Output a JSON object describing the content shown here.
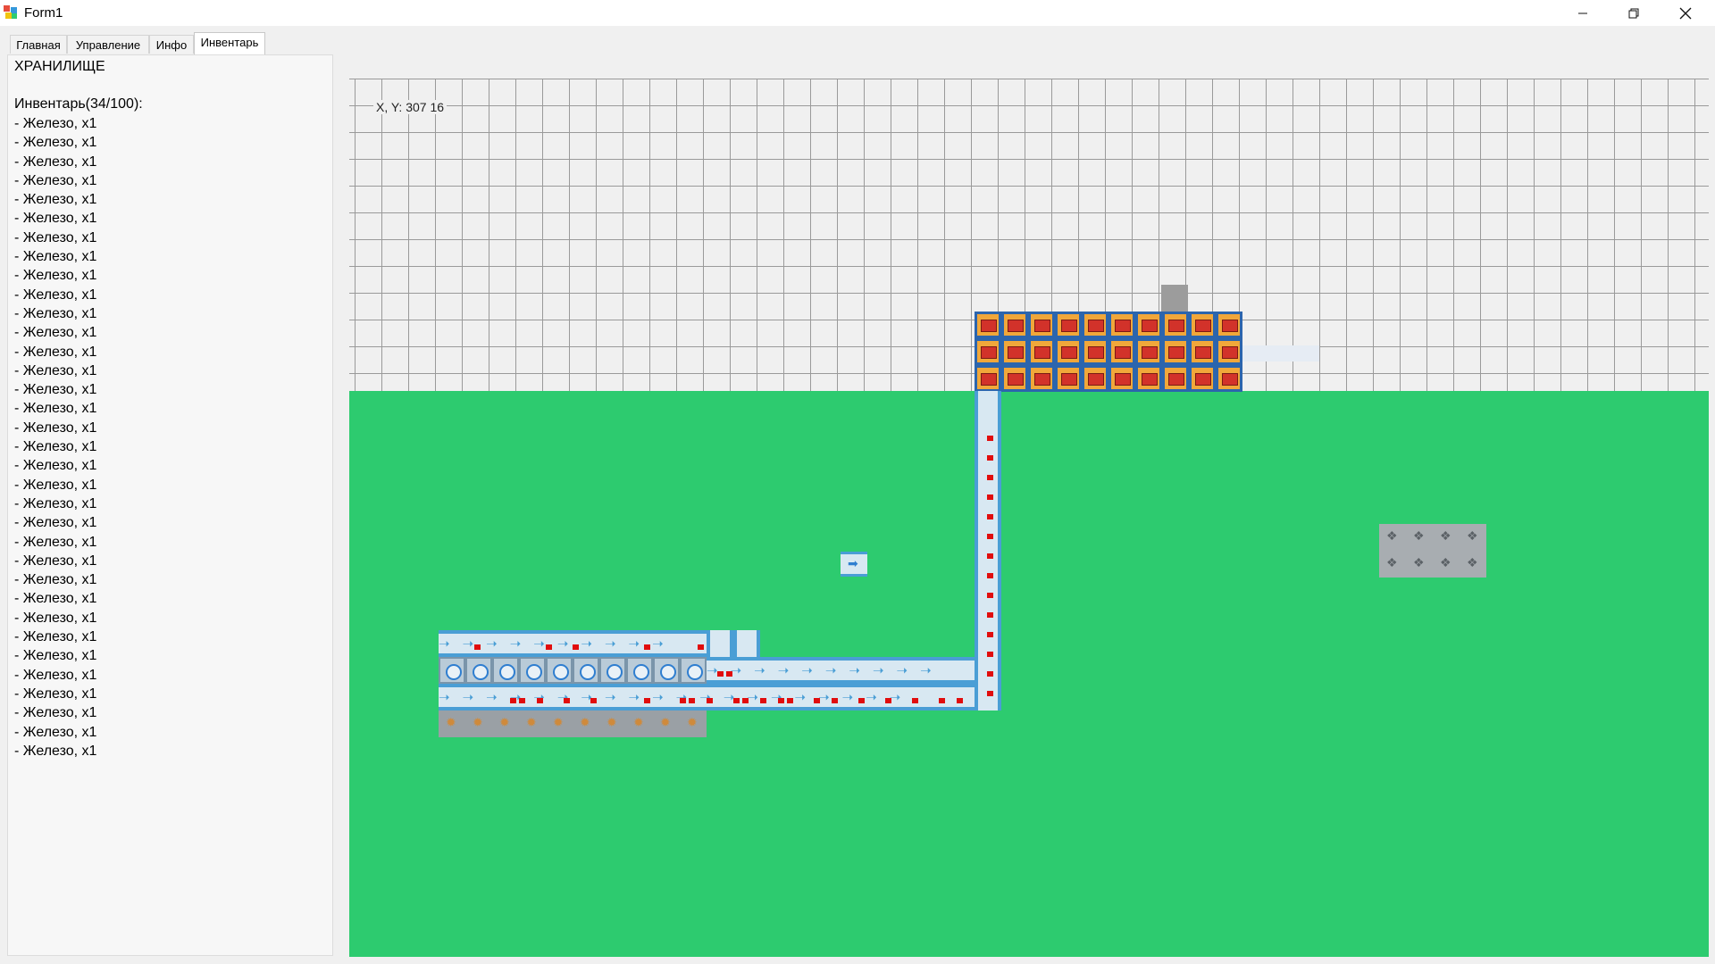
{
  "window": {
    "title": "Form1"
  },
  "window_controls": {
    "minimize": "minimize-icon",
    "restore": "restore-icon",
    "close": "close-icon"
  },
  "tabs": [
    {
      "label": "Главная"
    },
    {
      "label": "Управление"
    },
    {
      "label": "Инфо"
    },
    {
      "label": "Инвентарь",
      "active": true
    }
  ],
  "storage": {
    "title": "ХРАНИЛИЩЕ",
    "inventory_header": "Инвентарь(34/100):",
    "items": [
      "- Железо, x1",
      "- Железо, x1",
      "- Железо, x1",
      "- Железо, x1",
      "- Железо, x1",
      "- Железо, x1",
      "- Железо, x1",
      "- Железо, x1",
      "- Железо, x1",
      "- Железо, x1",
      "- Железо, x1",
      "- Железо, x1",
      "- Железо, x1",
      "- Железо, x1",
      "- Железо, x1",
      "- Железо, x1",
      "- Железо, x1",
      "- Железо, x1",
      "- Железо, x1",
      "- Железо, x1",
      "- Железо, x1",
      "- Железо, x1",
      "- Железо, x1",
      "- Железо, x1",
      "- Железо, x1",
      "- Железо, x1",
      "- Железо, x1",
      "- Железо, x1",
      "- Железо, x1",
      "- Железо, x1",
      "- Железо, x1",
      "- Железо, x1",
      "- Железо, x1",
      "- Железо, x1"
    ]
  },
  "game": {
    "coords_label": "X, Y: 307 16",
    "colors": {
      "ground": "#2dcb6f",
      "grid_bg": "#f0f0f0",
      "grid_line": "#9a9a9a",
      "belt": "#4a9ed5",
      "item": "#e10d0d"
    }
  }
}
